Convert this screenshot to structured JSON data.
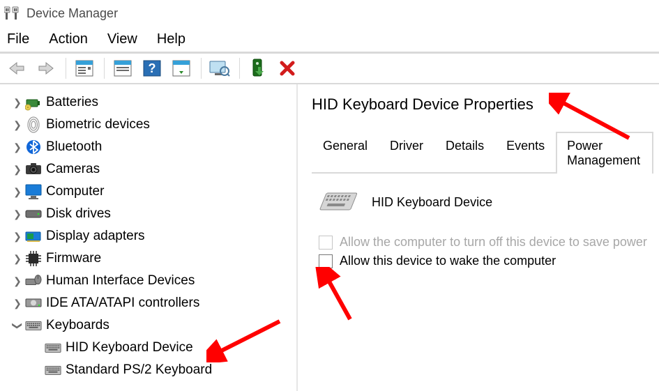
{
  "title": "Device Manager",
  "menu": {
    "file": "File",
    "action": "Action",
    "view": "View",
    "help": "Help"
  },
  "tree": {
    "batteries": "Batteries",
    "biometric": "Biometric devices",
    "bluetooth": "Bluetooth",
    "cameras": "Cameras",
    "computer": "Computer",
    "disk": "Disk drives",
    "display": "Display adapters",
    "firmware": "Firmware",
    "hid": "Human Interface Devices",
    "ide": "IDE ATA/ATAPI controllers",
    "keyboards": "Keyboards",
    "kbd_hid": "HID Keyboard Device",
    "kbd_ps2": "Standard PS/2 Keyboard"
  },
  "props": {
    "title": "HID Keyboard Device Properties",
    "device_name": "HID Keyboard Device",
    "tabs": {
      "general": "General",
      "driver": "Driver",
      "details": "Details",
      "events": "Events",
      "power": "Power Management"
    },
    "opt_turnoff": "Allow the computer to turn off this device to save power",
    "opt_wake": "Allow this device to wake the computer"
  }
}
